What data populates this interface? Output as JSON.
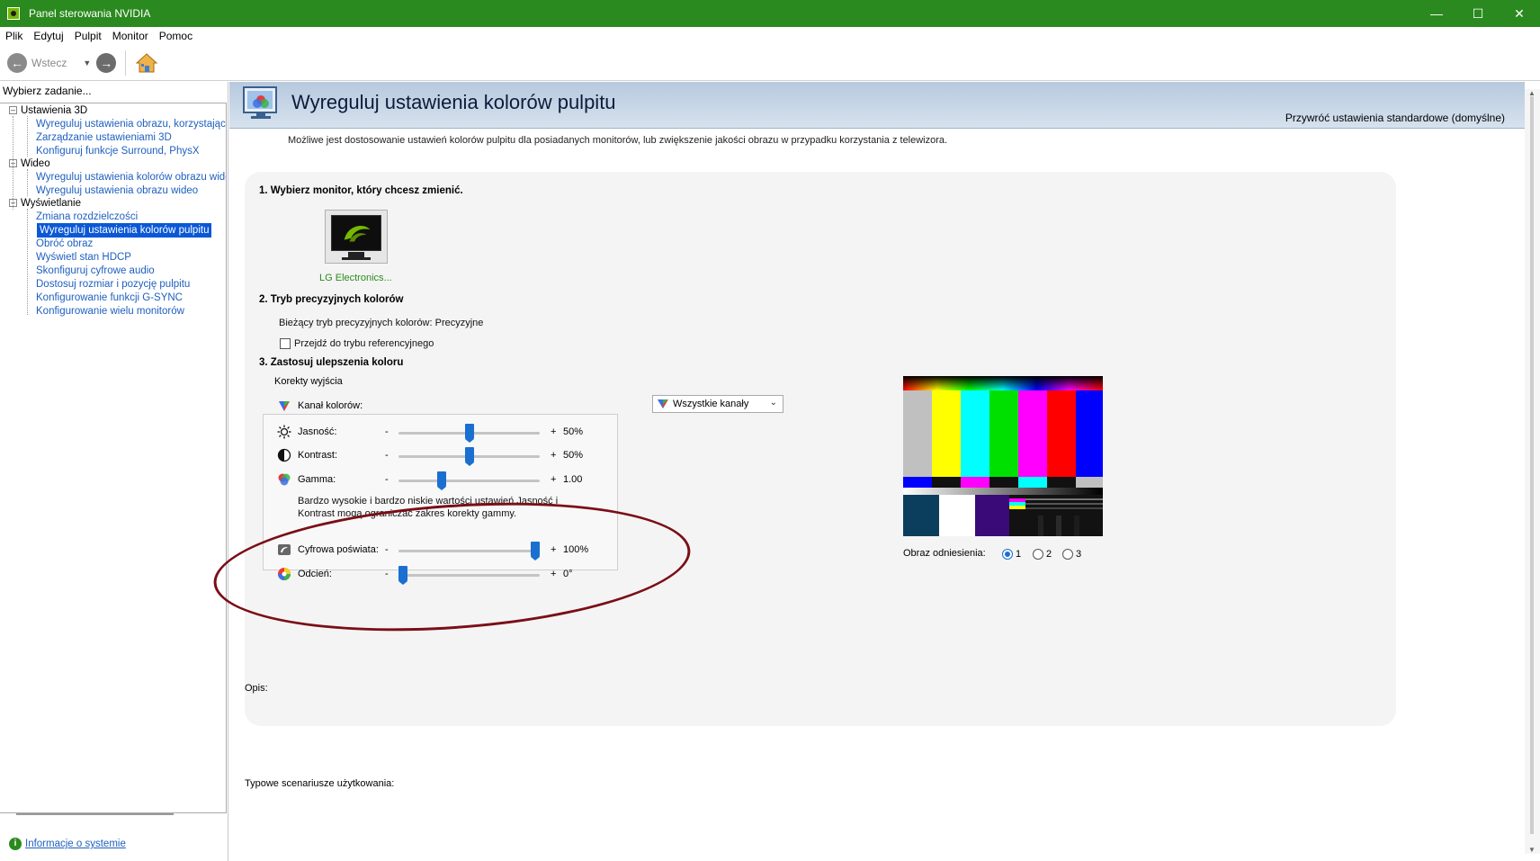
{
  "window": {
    "title": "Panel sterowania NVIDIA",
    "minimize": "—",
    "maximize": "☐",
    "close": "✕"
  },
  "menu": [
    "Plik",
    "Edytuj",
    "Pulpit",
    "Monitor",
    "Pomoc"
  ],
  "toolbar": {
    "back_label": "Wstecz"
  },
  "sidebar": {
    "task_label": "Wybierz zadanie...",
    "categories": [
      {
        "label": "Ustawienia 3D",
        "items": [
          "Wyreguluj ustawienia obrazu, korzystając z",
          "Zarządzanie ustawieniami 3D",
          "Konfiguruj funkcje Surround, PhysX"
        ]
      },
      {
        "label": "Wideo",
        "items": [
          "Wyreguluj ustawienia kolorów obrazu wideo",
          "Wyreguluj ustawienia obrazu wideo"
        ]
      },
      {
        "label": "Wyświetlanie",
        "items": [
          "Zmiana rozdzielczości",
          "Wyreguluj ustawienia kolorów pulpitu",
          "Obróć obraz",
          "Wyświetl stan HDCP",
          "Skonfiguruj cyfrowe audio",
          "Dostosuj rozmiar i pozycję pulpitu",
          "Konfigurowanie funkcji G-SYNC",
          "Konfigurowanie wielu monitorów"
        ]
      }
    ],
    "selected": "Wyreguluj ustawienia kolorów pulpitu",
    "info_link": "Informacje o systemie"
  },
  "main": {
    "title": "Wyreguluj ustawienia kolorów pulpitu",
    "restore_link": "Przywróć ustawienia standardowe (domyślne)",
    "intro": "Możliwe jest dostosowanie ustawień kolorów pulpitu dla posiadanych monitorów, lub zwiększenie jakości obrazu w przypadku korzystania z telewizora.",
    "step1": {
      "title": "1. Wybierz monitor, który chcesz zmienić.",
      "monitor_label": "LG Electronics..."
    },
    "step2": {
      "title": "2. Tryb precyzyjnych kolorów",
      "current_mode": "Bieżący tryb precyzyjnych kolorów: Precyzyjne",
      "checkbox_label": "Przejdź do trybu referencyjnego",
      "checkbox_checked": false
    },
    "step3": {
      "title": "3. Zastosuj ulepszenia koloru",
      "group_label": "Korekty wyjścia",
      "channel_label": "Kanał kolorów:",
      "channel_value": "Wszystkie kanały",
      "sliders": [
        {
          "label": "Jasność:",
          "value": "50%",
          "fraction": 0.5
        },
        {
          "label": "Kontrast:",
          "value": "50%",
          "fraction": 0.5
        },
        {
          "label": "Gamma:",
          "value": "1.00",
          "fraction": 0.29
        }
      ],
      "warning": "Bardzo wysokie i bardzo niskie wartości ustawień Jasność i Kontrast mogą ograniczać zakres korekty gammy.",
      "extra_sliders": [
        {
          "label": "Cyfrowa poświata:",
          "value": "100%",
          "fraction": 1.0
        },
        {
          "label": "Odcień:",
          "value": "0°",
          "fraction": 0.0
        }
      ],
      "minus": "-",
      "plus": "+",
      "reference_label": "Obraz odniesienia:",
      "reference_options": [
        "1",
        "2",
        "3"
      ],
      "reference_selected": "1"
    },
    "opis_label": "Opis:",
    "scenarios_label": "Typowe scenariusze użytkowania:"
  },
  "colors": {
    "titlebar": "#2b8a1f",
    "link": "#1e5fbf",
    "selection": "#0a58d6",
    "slider_thumb": "#1a6fd1",
    "annotation_ellipse": "#7a0e16"
  }
}
